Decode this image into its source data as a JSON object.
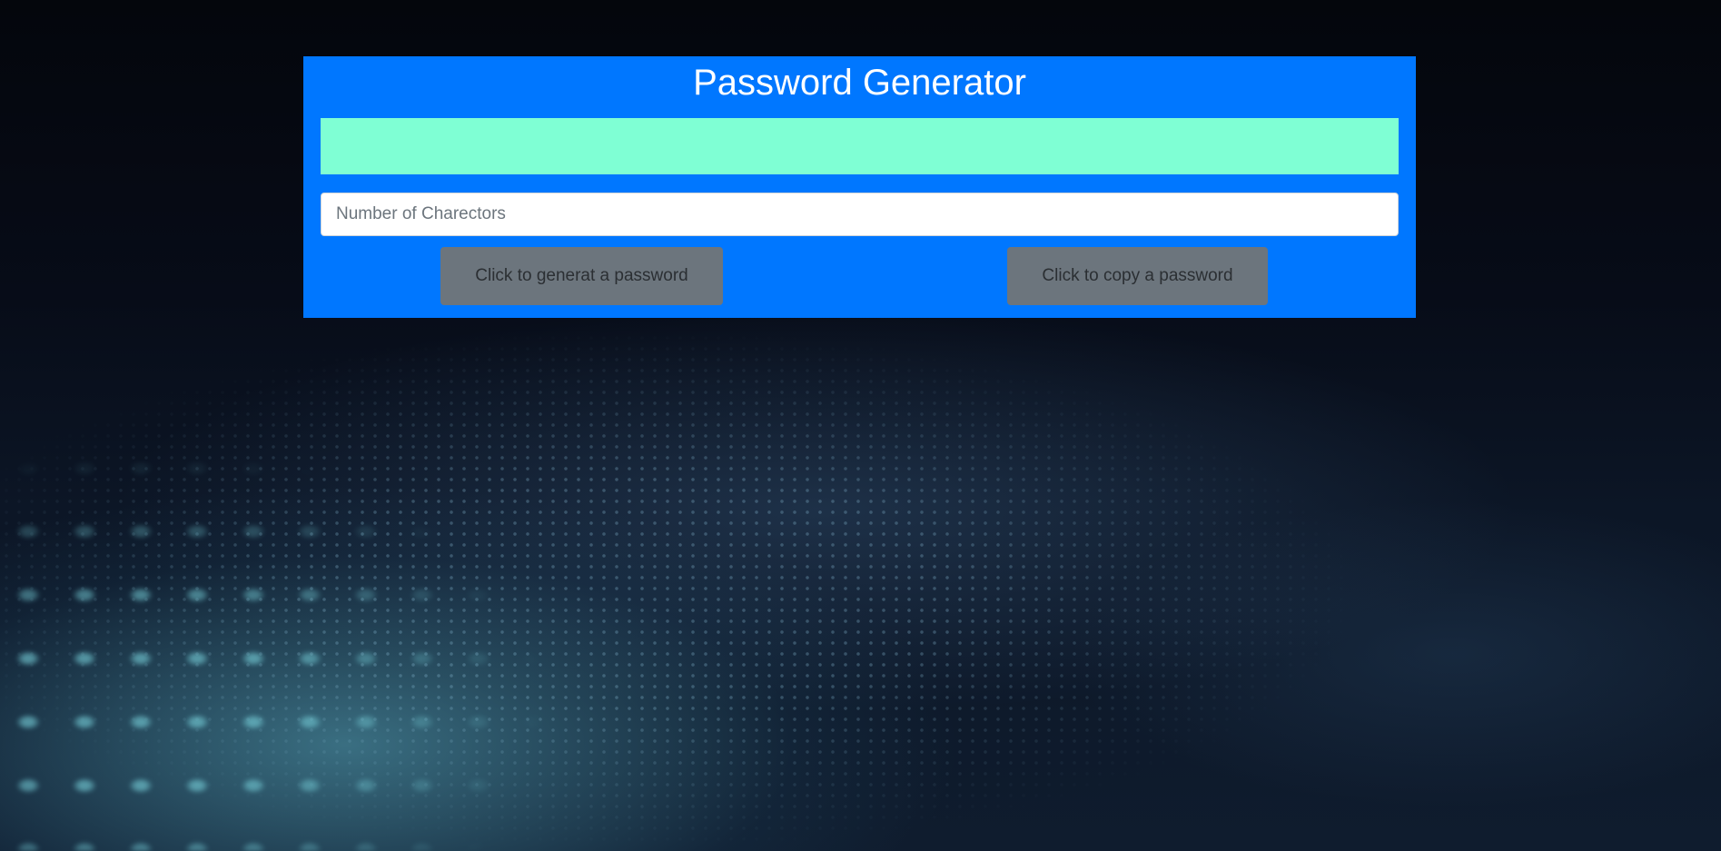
{
  "app": {
    "title": "Password Generator"
  },
  "output": {
    "value": ""
  },
  "length_input": {
    "value": "",
    "placeholder": "Number of Charectors"
  },
  "buttons": {
    "generate_label": "Click to generat a password",
    "copy_label": "Click to copy a password"
  },
  "colors": {
    "panel": "#0077ff",
    "output_background": "#7fffd4",
    "button": "#6c757d",
    "title_text": "#ffffff"
  }
}
